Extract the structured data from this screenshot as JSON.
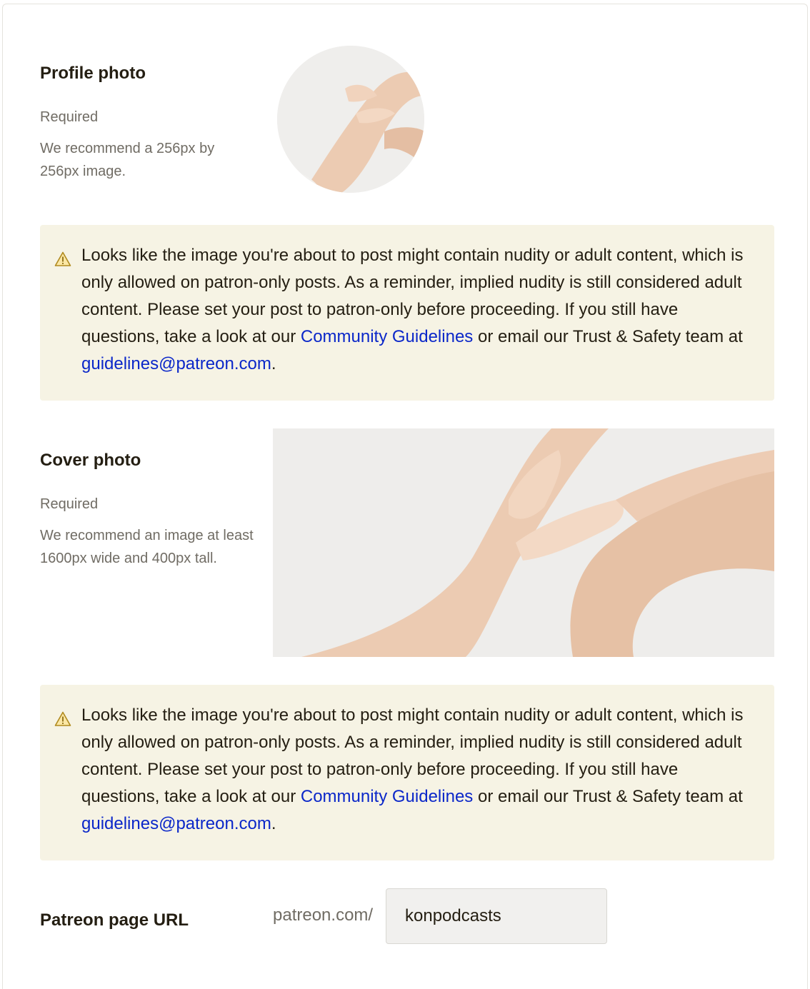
{
  "profile_photo": {
    "title": "Profile photo",
    "required": "Required",
    "hint": "We recommend a 256px by 256px image."
  },
  "warning": {
    "icon": "warning-triangle-icon",
    "text_before_link": "Looks like the image you're about to post might contain nudity or adult content, which is only allowed on patron-only posts. As a reminder, implied nudity is still considered adult content. Please set your post to patron-only before proceeding. If you still have questions, take a look at our ",
    "guidelines_link": "Community Guidelines",
    "text_between": " or email our Trust & Safety team at ",
    "email_link": "guidelines@patreon.com",
    "text_after": "."
  },
  "cover_photo": {
    "title": "Cover photo",
    "required": "Required",
    "hint": "We recommend an image at least 1600px wide and 400px tall."
  },
  "page_url": {
    "title": "Patreon page URL",
    "prefix": "patreon.com/",
    "value": "konpodcasts"
  },
  "colors": {
    "warning_bg": "#f6f3e4",
    "link": "#0b27c9",
    "muted_text": "#706c64",
    "heading_text": "#241e12"
  }
}
